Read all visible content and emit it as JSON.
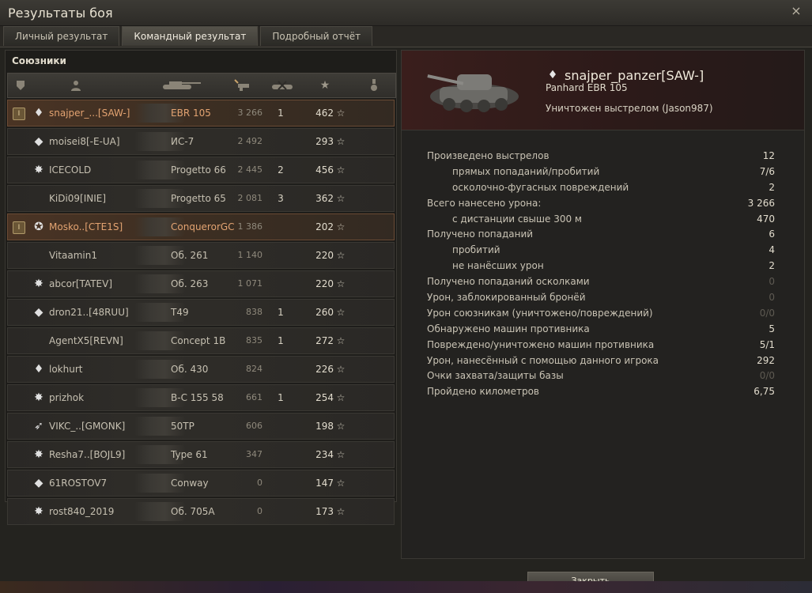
{
  "window": {
    "title": "Результаты боя",
    "close_icon": "×"
  },
  "tabs": [
    {
      "label": "Личный результат"
    },
    {
      "label": "Командный результат",
      "active": true
    },
    {
      "label": "Подробный отчёт"
    }
  ],
  "allies": {
    "title": "Союзники",
    "columns": [
      "squad-icon",
      "player-icon",
      "tank-icon",
      "damage-icon",
      "kills-icon",
      "xp-star-icon",
      "medal-icon"
    ],
    "rows": [
      {
        "badge": "I",
        "rank_icon": "♦",
        "name": "snajper_...[SAW-]",
        "vehicle": "EBR 105",
        "damage": "3 266",
        "kills": "1",
        "xp": "462",
        "star": "☆",
        "highlight": true
      },
      {
        "badge": "",
        "rank_icon": "◆",
        "name": "moisei8[-E-UA]",
        "vehicle": "ИС-7",
        "damage": "2 492",
        "kills": "",
        "xp": "293",
        "star": "☆",
        "highlight": false
      },
      {
        "badge": "",
        "rank_icon": "✸",
        "name": "ICECOLD",
        "vehicle": "Progetto 66",
        "damage": "2 445",
        "kills": "2",
        "xp": "456",
        "star": "☆",
        "highlight": false
      },
      {
        "badge": "",
        "rank_icon": "",
        "name": "KiDi09[INIE]",
        "vehicle": "Progetto 65",
        "damage": "2 081",
        "kills": "3",
        "xp": "362",
        "star": "☆",
        "highlight": false
      },
      {
        "badge": "I",
        "rank_icon": "✪",
        "name": "Mosko..[CTE1S]",
        "vehicle": "ConquerorGC",
        "damage": "1 386",
        "kills": "",
        "xp": "202",
        "star": "☆",
        "highlight": true
      },
      {
        "badge": "",
        "rank_icon": "",
        "name": "Vitaamin1",
        "vehicle": "Об. 261",
        "damage": "1 140",
        "kills": "",
        "xp": "220",
        "star": "☆",
        "highlight": false
      },
      {
        "badge": "",
        "rank_icon": "✸",
        "name": "abcor[TATEV]",
        "vehicle": "Об. 263",
        "damage": "1 071",
        "kills": "",
        "xp": "220",
        "star": "☆",
        "highlight": false
      },
      {
        "badge": "",
        "rank_icon": "◆",
        "name": "dron21..[48RUU]",
        "vehicle": "T49",
        "damage": "838",
        "kills": "1",
        "xp": "260",
        "star": "☆",
        "highlight": false
      },
      {
        "badge": "",
        "rank_icon": "",
        "name": "AgentX5[REVN]",
        "vehicle": "Concept 1B",
        "damage": "835",
        "kills": "1",
        "xp": "272",
        "star": "☆",
        "highlight": false
      },
      {
        "badge": "",
        "rank_icon": "♦",
        "name": "lokhurt",
        "vehicle": "Об. 430",
        "damage": "824",
        "kills": "",
        "xp": "226",
        "star": "☆",
        "highlight": false
      },
      {
        "badge": "",
        "rank_icon": "✸",
        "name": "prizhok",
        "vehicle": "B-C 155 58",
        "damage": "661",
        "kills": "1",
        "xp": "254",
        "star": "☆",
        "highlight": false
      },
      {
        "badge": "",
        "rank_icon": "➶",
        "name": "VIKC_..[GMONK]",
        "vehicle": "50TP",
        "damage": "606",
        "kills": "",
        "xp": "198",
        "star": "☆",
        "highlight": false
      },
      {
        "badge": "",
        "rank_icon": "✸",
        "name": "Resha7..[BOJL9]",
        "vehicle": "Type 61",
        "damage": "347",
        "kills": "",
        "xp": "234",
        "star": "☆",
        "highlight": false
      },
      {
        "badge": "",
        "rank_icon": "◆",
        "name": "61ROSTOV7",
        "vehicle": "Conway",
        "damage": "0",
        "kills": "",
        "xp": "147",
        "star": "☆",
        "highlight": false
      },
      {
        "badge": "",
        "rank_icon": "✸",
        "name": "rost840_2019",
        "vehicle": "Об. 705А",
        "damage": "0",
        "kills": "",
        "xp": "173",
        "star": "☆",
        "highlight": false
      }
    ]
  },
  "player": {
    "emblem_icon": "♦",
    "name": "snajper_panzer[SAW-]",
    "vehicle": "Panhard EBR 105",
    "killed_by": "Уничтожен выстрелом (Jason987)"
  },
  "stats": [
    {
      "label": "Произведено выстрелов",
      "value": "12",
      "indent": false,
      "dim": false
    },
    {
      "label": "прямых попаданий/пробитий",
      "value": "7/6",
      "indent": true,
      "dim": false
    },
    {
      "label": "осколочно-фугасных повреждений",
      "value": "2",
      "indent": true,
      "dim": false
    },
    {
      "label": "Всего нанесено урона:",
      "value": "3 266",
      "indent": false,
      "dim": false
    },
    {
      "label": "с дистанции свыше 300 м",
      "value": "470",
      "indent": true,
      "dim": false
    },
    {
      "label": "Получено попаданий",
      "value": "6",
      "indent": false,
      "dim": false
    },
    {
      "label": "пробитий",
      "value": "4",
      "indent": true,
      "dim": false
    },
    {
      "label": "не нанёсших урон",
      "value": "2",
      "indent": true,
      "dim": false
    },
    {
      "label": "Получено попаданий осколками",
      "value": "0",
      "indent": false,
      "dim": true
    },
    {
      "label": "Урон, заблокированный бронёй",
      "value": "0",
      "indent": false,
      "dim": true
    },
    {
      "label": "Урон союзникам (уничтожено/повреждений)",
      "value": "0/0",
      "indent": false,
      "dim": true
    },
    {
      "label": "Обнаружено машин противника",
      "value": "5",
      "indent": false,
      "dim": false
    },
    {
      "label": "Повреждено/уничтожено машин противника",
      "value": "5/1",
      "indent": false,
      "dim": false
    },
    {
      "label": "Урон, нанесённый с помощью данного игрока",
      "value": "292",
      "indent": false,
      "dim": false
    },
    {
      "label": "Очки захвата/защиты базы",
      "value": "0/0",
      "indent": false,
      "dim": true
    },
    {
      "label": "Пройдено километров",
      "value": "6,75",
      "indent": false,
      "dim": false
    }
  ],
  "buttons": {
    "close_label": "Закрыть"
  }
}
